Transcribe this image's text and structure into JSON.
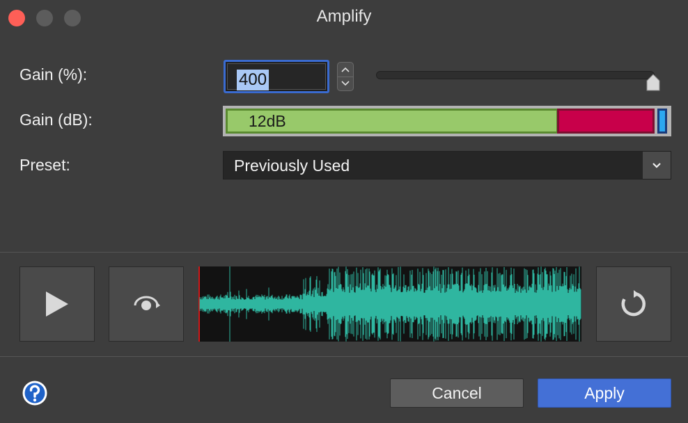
{
  "window": {
    "title": "Amplify"
  },
  "labels": {
    "gain_percent": "Gain (%):",
    "gain_db": "Gain (dB):",
    "preset": "Preset:"
  },
  "gain_percent": {
    "value": "400",
    "slider_level": 1.0
  },
  "gain_db": {
    "value": "12dB"
  },
  "preset": {
    "selected": "Previously Used"
  },
  "buttons": {
    "cancel": "Cancel",
    "apply": "Apply"
  },
  "colors": {
    "accent": "#4470d6",
    "meter_green": "#98c96a",
    "meter_red": "#c8004a",
    "meter_handle": "#2da8f0",
    "waveform": "#2fb6a0",
    "close": "#fe5f57"
  },
  "icons": {
    "play": "play-icon",
    "loop_play": "loop-play-icon",
    "refresh": "refresh-icon",
    "help": "help-icon",
    "chevron": "chevron-down-icon"
  }
}
